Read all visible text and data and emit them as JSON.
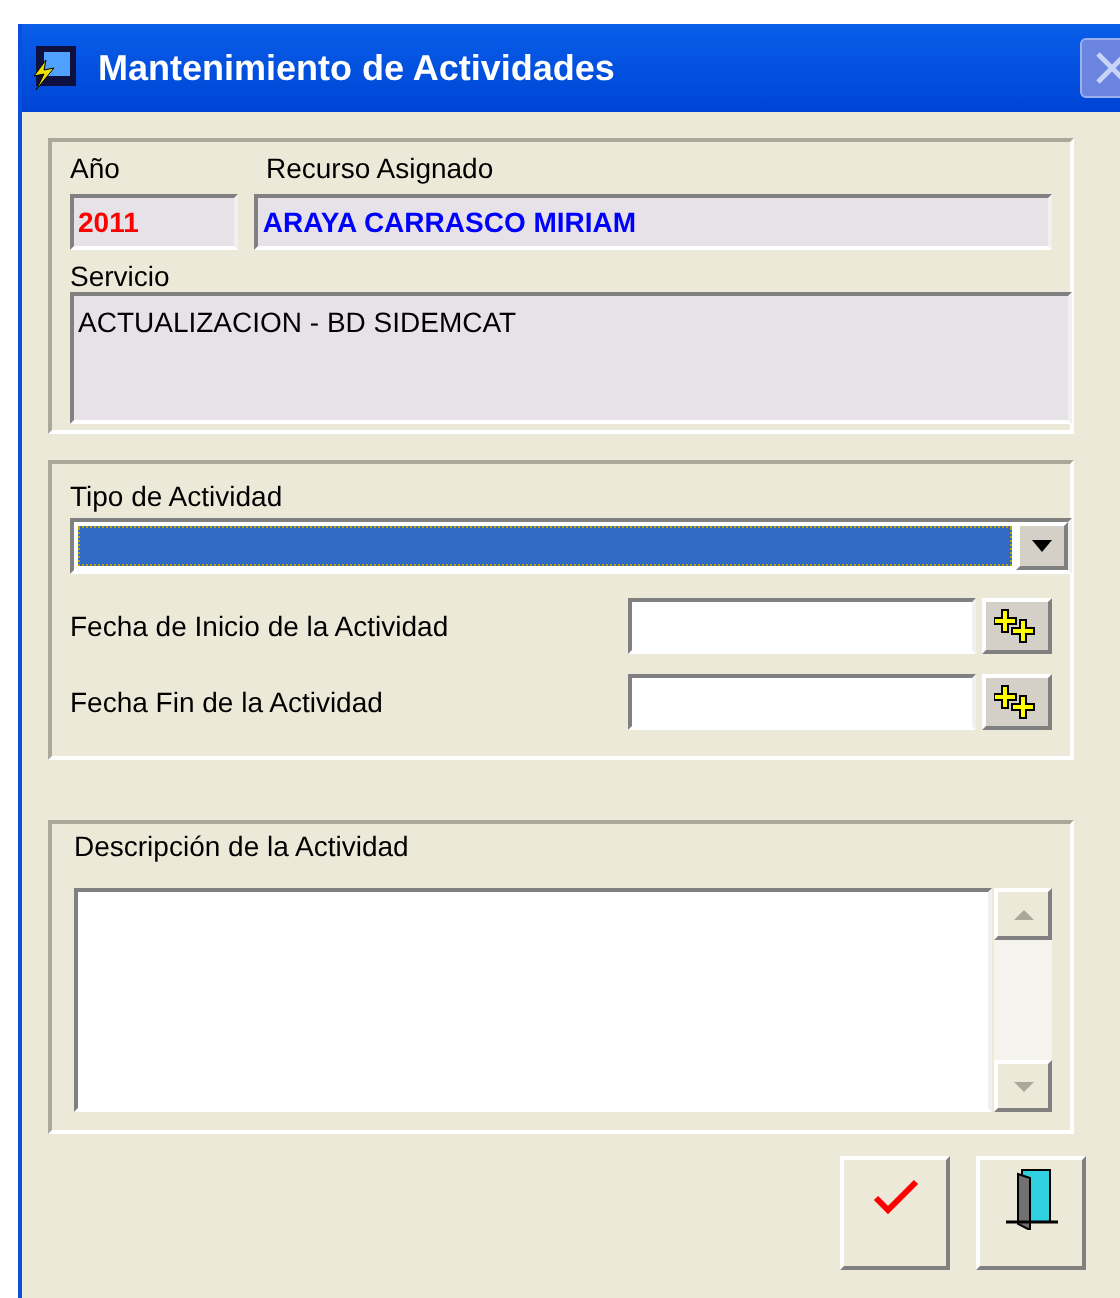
{
  "window": {
    "title": "Mantenimiento de Actividades"
  },
  "assignment": {
    "year_label": "Año",
    "year": "2011",
    "resource_label": "Recurso Asignado",
    "resource": "ARAYA CARRASCO MIRIAM",
    "service_label": "Servicio",
    "service": "ACTUALIZACION - BD SIDEMCAT"
  },
  "activity": {
    "type_label": "Tipo de Actividad",
    "type_focused": true,
    "dates": [
      {
        "label": "Fecha de Inicio de la Actividad"
      },
      {
        "label": "Fecha Fin de la Actividad"
      }
    ]
  },
  "description": {
    "label": "Descripción de la Actividad"
  }
}
